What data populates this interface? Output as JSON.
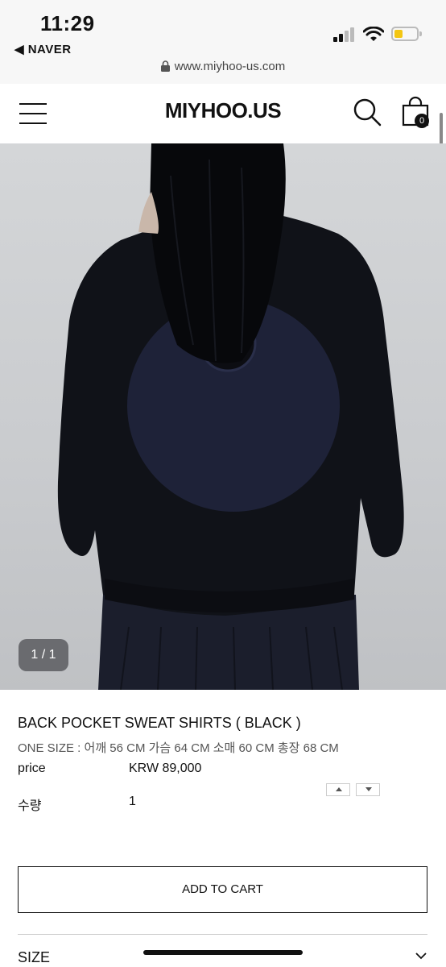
{
  "status": {
    "time": "11:29",
    "back_app": "◀ NAVER",
    "url": "www.miyhoo-us.com"
  },
  "header": {
    "logo": "MIYHOO.US",
    "cart_count": "0"
  },
  "gallery": {
    "counter": "1 / 1"
  },
  "product": {
    "title": "BACK POCKET SWEAT SHIRTS ( BLACK )",
    "size_info": "ONE SIZE : 어깨 56 CM 가슴 64 CM 소매 60 CM 총장 68 CM",
    "price_label": "price",
    "price_value": "KRW 89,000",
    "qty_label": "수량",
    "qty_value": "1",
    "add_to_cart": "ADD TO CART",
    "size_section": "SIZE"
  },
  "colors": {
    "accent": "#111111",
    "battery": "#f3c613",
    "sweatshirt": "#101218",
    "pocket": "#1e2238"
  }
}
